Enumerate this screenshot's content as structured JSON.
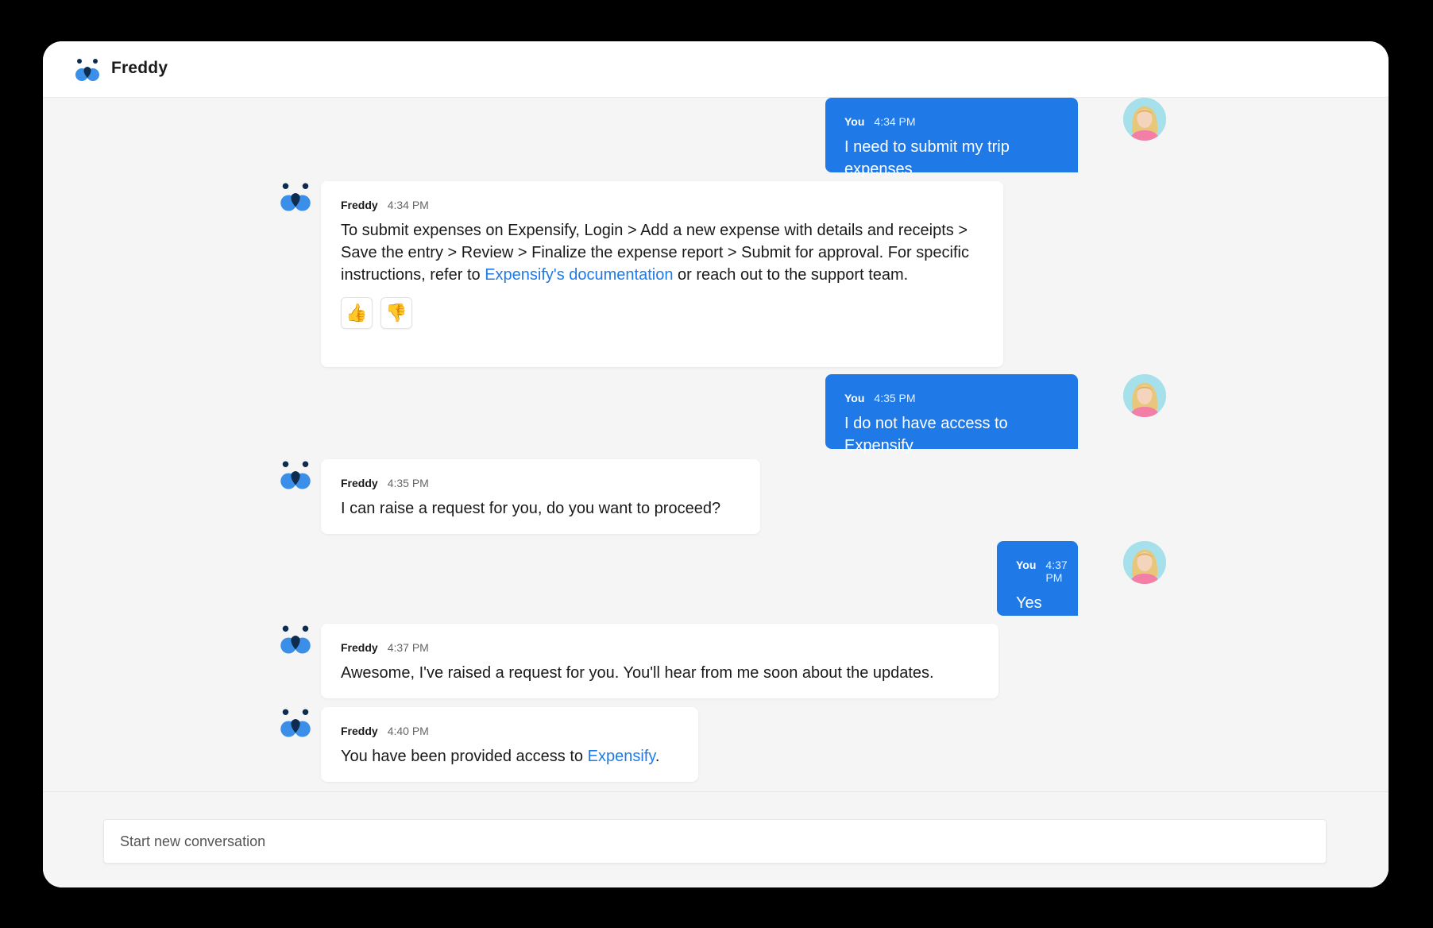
{
  "app": {
    "title": "Freddy"
  },
  "colors": {
    "user_bubble": "#1f7ae8",
    "link": "#1f7ae8",
    "logo_dark": "#0d2c4f",
    "logo_light": "#3b8fe8"
  },
  "messages": [
    {
      "sender": "You",
      "time": "4:34 PM",
      "text": "I need to submit my trip expenses"
    },
    {
      "sender": "Freddy",
      "time": "4:34 PM",
      "text_before": "To submit expenses on Expensify, Login > Add a new expense with details and receipts > Save the entry > Review > Finalize the expense report > Submit for approval. For specific instructions, refer to ",
      "link": "Expensify's documentation",
      "text_after": " or reach out to the support team.",
      "reactions": {
        "thumbs_up": "👍",
        "thumbs_down": "👎"
      }
    },
    {
      "sender": "You",
      "time": "4:35 PM",
      "text": "I do not have access to Expensify"
    },
    {
      "sender": "Freddy",
      "time": "4:35 PM",
      "text": "I can raise a request for you, do you want to proceed?"
    },
    {
      "sender": "You",
      "time": "4:37 PM",
      "text": "Yes"
    },
    {
      "sender": "Freddy",
      "time": "4:37 PM",
      "text": "Awesome, I've raised a request for you. You'll hear from me soon about the updates."
    },
    {
      "sender": "Freddy",
      "time": "4:40 PM",
      "text_before": "You have been provided access to ",
      "link": "Expensify",
      "text_after": "."
    }
  ],
  "composer": {
    "placeholder": "Start new conversation"
  }
}
